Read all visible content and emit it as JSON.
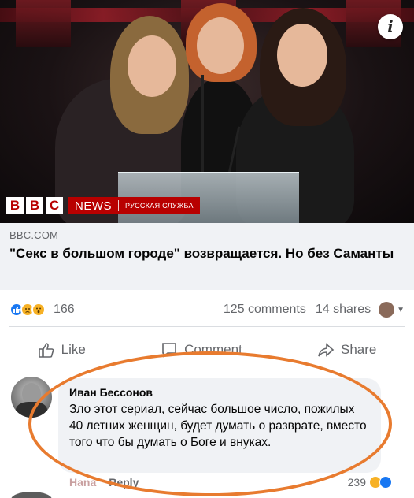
{
  "photo": {
    "info_badge": "i",
    "bbc_letters": [
      "B",
      "B",
      "C"
    ],
    "bbc_news": "NEWS",
    "bbc_service": "РУССКАЯ СЛУЖБА"
  },
  "link_preview": {
    "domain": "BBC.COM",
    "title": "\"Секс в большом городе\" возвращается. Но без Саманты"
  },
  "stats": {
    "reaction_icons": [
      "like-icon",
      "sad-icon",
      "wow-icon"
    ],
    "reaction_count": "166",
    "comments": "125 comments",
    "shares": "14 shares"
  },
  "actions": {
    "like": "Like",
    "comment": "Comment",
    "share": "Share"
  },
  "comment": {
    "author": "Иван Бессонов",
    "text": "Зло этот сериал, сейчас большое число, пожилых 40 летних женщин, будет думать о разврате, вместо того что бы думать о Боге и внуках.",
    "like_label": "Hana",
    "reply_label": "Reply",
    "reaction_count": "239",
    "reaction_icons": [
      "haha-icon",
      "like-icon"
    ]
  },
  "colors": {
    "facebook_blue": "#1877f2",
    "bbc_red": "#b80000",
    "highlight_orange": "#e87b2f"
  }
}
